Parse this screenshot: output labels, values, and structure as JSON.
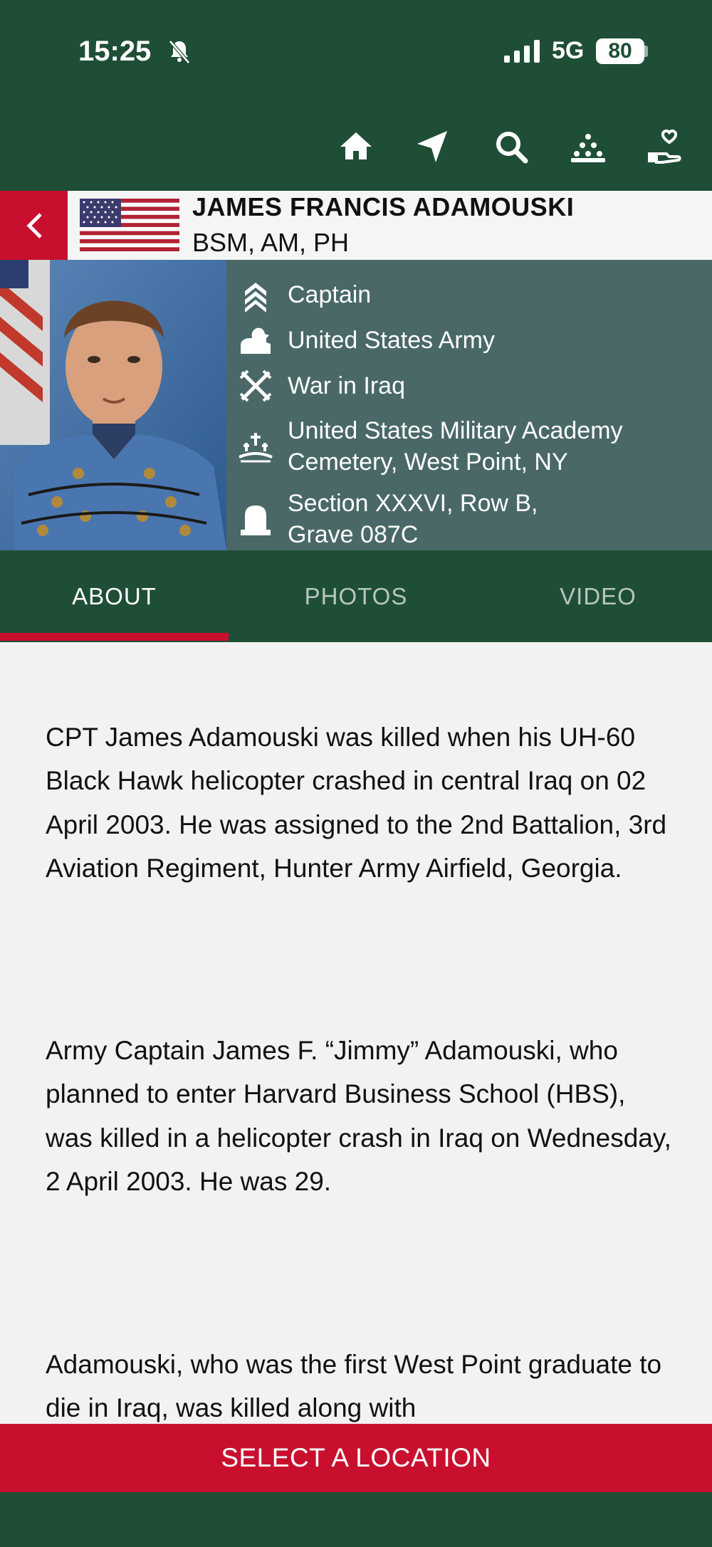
{
  "status_bar": {
    "time": "15:25",
    "network": "5G",
    "battery": "80"
  },
  "nav": {
    "icons": [
      "home-icon",
      "location-arrow-icon",
      "search-icon",
      "group-icon",
      "donate-icon"
    ]
  },
  "profile": {
    "name": "JAMES FRANCIS ADAMOUSKI",
    "awards": "BSM, AM, PH",
    "rank": "Captain",
    "branch": "United States Army",
    "conflict": "War in Iraq",
    "cemetery_line1": "United States Military Academy",
    "cemetery_line2": "Cemetery, West Point, NY",
    "grave_line1": "Section XXXVI, Row B,",
    "grave_line2": "Grave 087C"
  },
  "tabs": [
    {
      "label": "ABOUT",
      "active": true
    },
    {
      "label": "PHOTOS",
      "active": false
    },
    {
      "label": "VIDEO",
      "active": false
    }
  ],
  "about": {
    "paragraphs": [
      "CPT James Adamouski was killed when his UH-60 Black Hawk helicopter crashed in central Iraq on 02 April 2003. He was assigned to the 2nd Battalion, 3rd Aviation Regiment, Hunter Army Airfield, Georgia.",
      "Army Captain James F. “Jimmy” Adamouski, who planned to enter Harvard Business School (HBS), was killed in a helicopter crash in Iraq on Wednesday, 2 April 2003. He was 29.",
      "Adamouski, who was the first West Point graduate to die in Iraq, was killed along with"
    ]
  },
  "footer": {
    "select_location_label": "SELECT A LOCATION"
  },
  "colors": {
    "brand_green": "#1f4e36",
    "accent_red": "#c8102e",
    "info_panel": "#4a6868"
  }
}
